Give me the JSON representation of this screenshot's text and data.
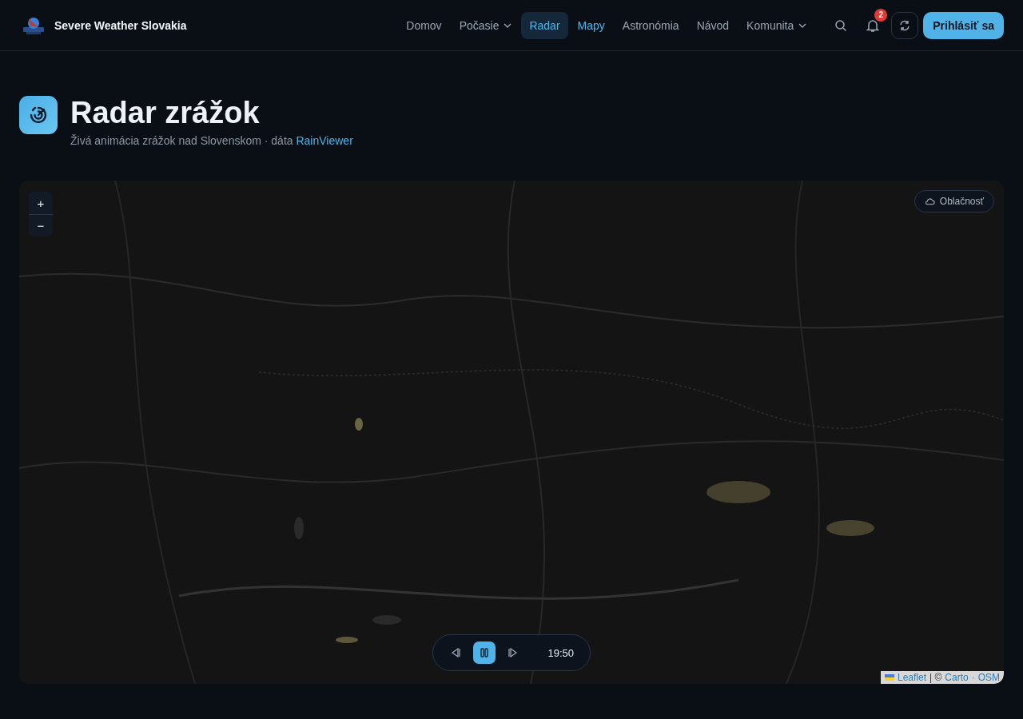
{
  "brand": {
    "name": "Severe Weather Slovakia"
  },
  "nav": [
    {
      "label": "Domov",
      "selected": false,
      "highlighted": false,
      "has_menu": false
    },
    {
      "label": "Počasie",
      "selected": false,
      "highlighted": false,
      "has_menu": true
    },
    {
      "label": "Radar",
      "selected": true,
      "highlighted": false,
      "has_menu": false
    },
    {
      "label": "Mapy",
      "selected": false,
      "highlighted": true,
      "has_menu": false
    },
    {
      "label": "Astronómia",
      "selected": false,
      "highlighted": false,
      "has_menu": false
    },
    {
      "label": "Návod",
      "selected": false,
      "highlighted": false,
      "has_menu": false
    },
    {
      "label": "Komunita",
      "selected": false,
      "highlighted": false,
      "has_menu": true
    }
  ],
  "notifications": {
    "count": "2"
  },
  "login_button": "Prihlásiť sa",
  "page": {
    "title": "Radar zrážok",
    "subtitle": "Živá animácia zrážok nad Slovenskom · dáta",
    "source_link": "RainViewer"
  },
  "map": {
    "zoom_in": "+",
    "zoom_out": "−",
    "layer_toggle": {
      "label": "Oblačnosť",
      "on": false
    },
    "player": {
      "playing": true,
      "time": "19:50"
    },
    "attribution": {
      "leaflet": "Leaflet",
      "separator": "| ©",
      "carto": "Carto",
      "dot": "·",
      "osm": "OSM"
    }
  }
}
